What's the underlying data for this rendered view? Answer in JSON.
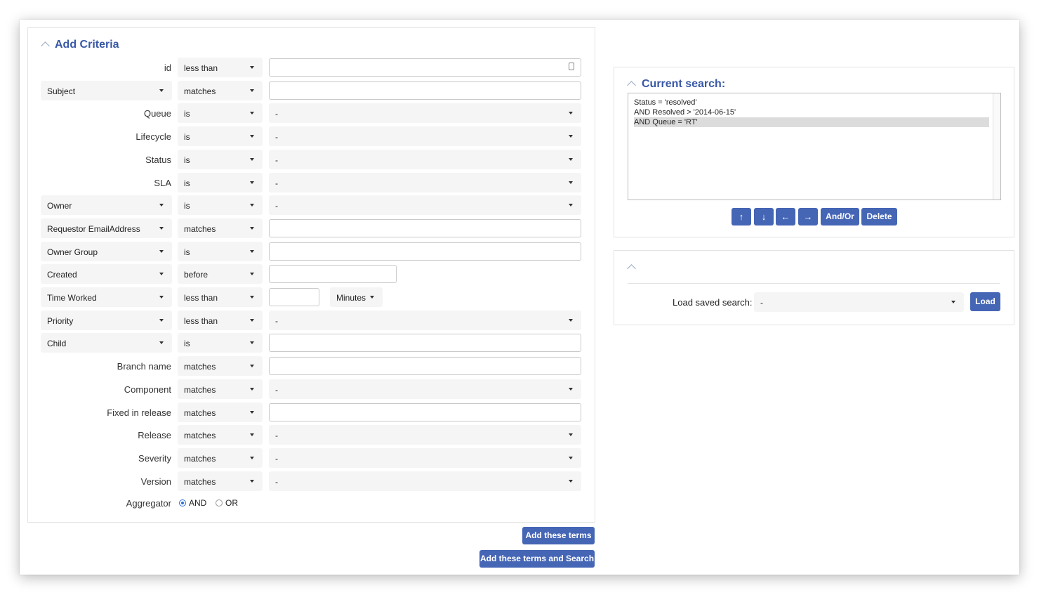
{
  "add_criteria": {
    "title": "Add Criteria",
    "rows": [
      {
        "field": "id",
        "op": "less than",
        "value_type": "input"
      },
      {
        "field": "Subject",
        "op": "matches",
        "value_type": "input",
        "field_select": true
      },
      {
        "field": "Queue",
        "op": "is",
        "value": "-",
        "value_type": "select"
      },
      {
        "field": "Lifecycle",
        "op": "is",
        "value": "-",
        "value_type": "select"
      },
      {
        "field": "Status",
        "op": "is",
        "value": "-",
        "value_type": "select"
      },
      {
        "field": "SLA",
        "op": "is",
        "value": "-",
        "value_type": "select"
      },
      {
        "field": "Owner",
        "op": "is",
        "value": "-",
        "value_type": "select",
        "field_select": true
      },
      {
        "field": "Requestor EmailAddress",
        "op": "matches",
        "value_type": "input",
        "field_select": true
      },
      {
        "field": "Owner Group",
        "op": "is",
        "value_type": "input",
        "field_select": true
      },
      {
        "field": "Created",
        "op": "before",
        "value_type": "input",
        "field_select": true
      },
      {
        "field": "Time Worked",
        "op": "less than",
        "value_type": "input",
        "unit": "Minutes",
        "field_select": true
      },
      {
        "field": "Priority",
        "op": "less than",
        "value": "-",
        "value_type": "select",
        "field_select": true
      },
      {
        "field": "Child",
        "op": "is",
        "value_type": "input",
        "field_select": true
      },
      {
        "field": "Branch name",
        "op": "matches",
        "value_type": "input"
      },
      {
        "field": "Component",
        "op": "matches",
        "value": "-",
        "value_type": "select"
      },
      {
        "field": "Fixed in release",
        "op": "matches",
        "value_type": "input"
      },
      {
        "field": "Release",
        "op": "matches",
        "value": "-",
        "value_type": "select"
      },
      {
        "field": "Severity",
        "op": "matches",
        "value": "-",
        "value_type": "select"
      },
      {
        "field": "Version",
        "op": "matches",
        "value": "-",
        "value_type": "select"
      }
    ],
    "aggregator": {
      "label": "Aggregator",
      "and": "AND",
      "or": "OR",
      "selected": "AND"
    }
  },
  "buttons": {
    "add_terms": "Add these terms",
    "add_terms_search": "Add these terms and Search"
  },
  "current_search": {
    "title": "Current search:",
    "lines": [
      "Status = 'resolved'",
      "AND Resolved > '2014-06-15'",
      "AND Queue = 'RT'"
    ],
    "selected_index": 2,
    "controls": {
      "up": "↑",
      "down": "↓",
      "left": "←",
      "right": "→",
      "andor": "And/Or",
      "delete": "Delete"
    }
  },
  "saved_search": {
    "label": "Load saved search:",
    "value": "-",
    "load": "Load"
  },
  "colors": {
    "accent": "#4565b5",
    "title": "#3858a6"
  }
}
